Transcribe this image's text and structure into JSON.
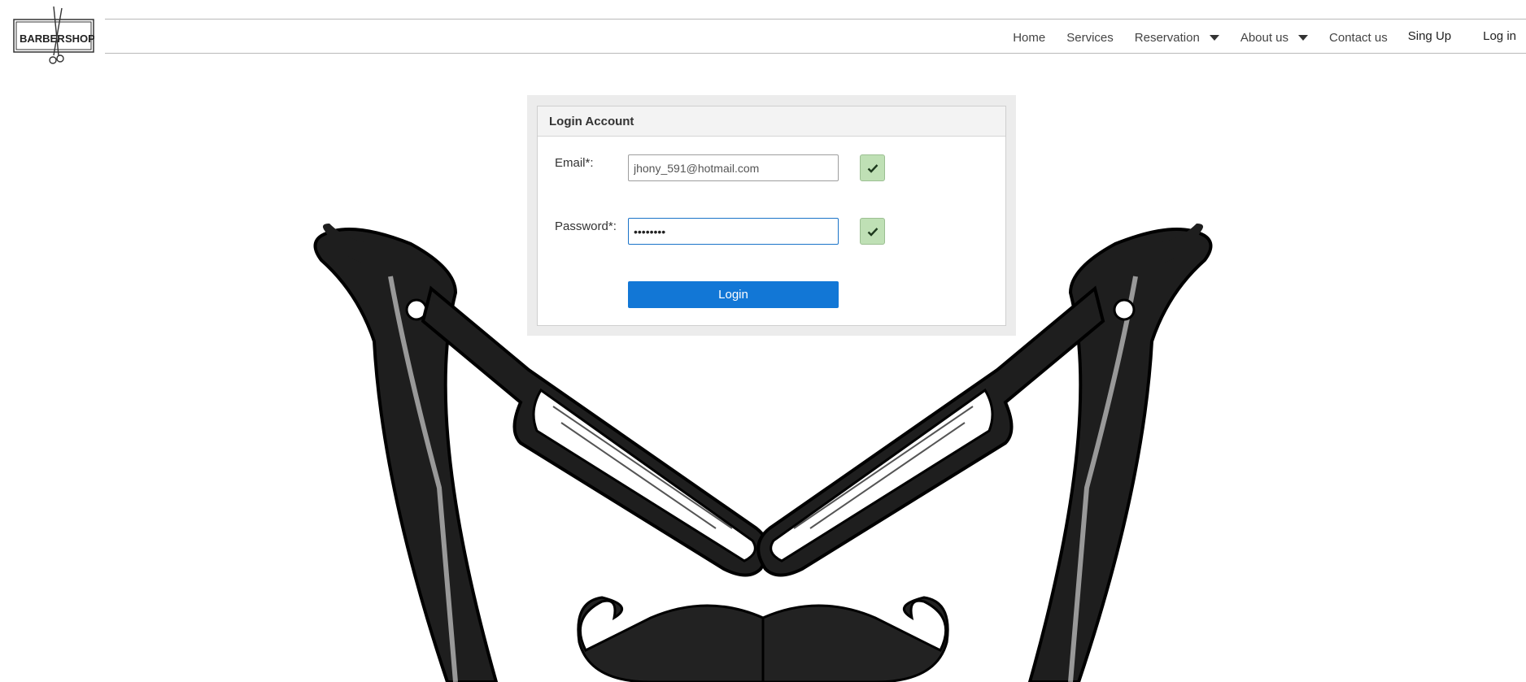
{
  "logo": {
    "left_text": "BARBER",
    "right_text": "SHOP"
  },
  "nav": {
    "home": "Home",
    "services": "Services",
    "reservation": "Reservation",
    "about": "About us",
    "contact": "Contact us",
    "signup": "Sing Up",
    "login": "Log in"
  },
  "login_panel": {
    "title": "Login Account",
    "email_label": "Email*:",
    "email_value": "jhony_591@hotmail.com",
    "password_label": "Password*:",
    "password_value": "••••••••",
    "submit_label": "Login"
  },
  "colors": {
    "accent": "#1277d6",
    "valid": "#bfe0b5",
    "focus": "#1a73c8"
  },
  "icons": [
    "check-icon",
    "caret-down-icon",
    "scissors-icon",
    "razor-icon",
    "mustache-icon"
  ]
}
